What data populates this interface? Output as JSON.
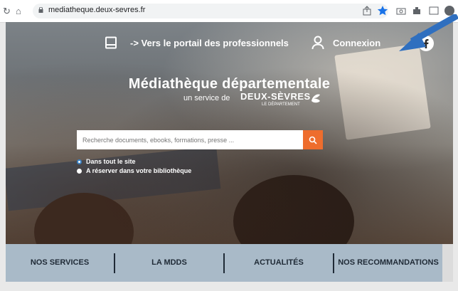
{
  "browser": {
    "url": "mediatheque.deux-sevres.fr",
    "back_symbol": "↻",
    "home_symbol": "⌂"
  },
  "header": {
    "pro_link": "-> Vers le portail des professionnels",
    "login": "Connexion"
  },
  "hero": {
    "title": "Médiathèque départementale",
    "subtitle": "un service de",
    "brand": "DEUX-SÈVRES",
    "brand_sub": "LE DÉPARTEMENT"
  },
  "search": {
    "placeholder": "Recherche documents, ebooks, formations, presse ...",
    "options": [
      "Dans tout le site",
      "A réserver dans votre bibliothèque"
    ],
    "selected": 0
  },
  "menu": {
    "items": [
      "NOS SERVICES",
      "LA MDDS",
      "ACTUALITÉS",
      "NOS RECOMMANDATIONS"
    ]
  },
  "colors": {
    "accent": "#ee6d2d",
    "menu_bg": "#a9bac8",
    "arrow": "#2f6fbf"
  }
}
